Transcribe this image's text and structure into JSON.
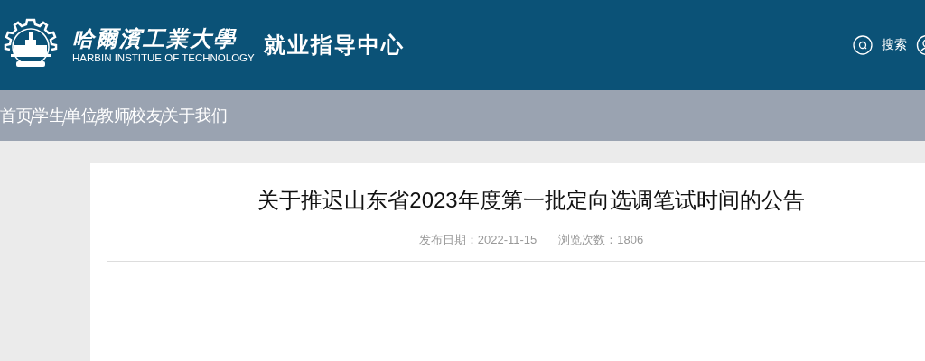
{
  "header": {
    "school_name_cn": "哈爾濱工業大學",
    "school_name_en": "HARBIN INSTITUE OF TECHNOLOGY",
    "site_title": "就业指导中心",
    "search_label": "搜索"
  },
  "nav": {
    "items": [
      {
        "label": "首页"
      },
      {
        "label": "学生"
      },
      {
        "label": "单位"
      },
      {
        "label": "教师"
      },
      {
        "label": "校友"
      },
      {
        "label": "关于我们"
      }
    ]
  },
  "article": {
    "title": "关于推迟山东省2023年度第一批定向选调笔试时间的公告",
    "publish_date": "发布日期：2022-11-15",
    "views": "浏览次数：1806"
  }
}
